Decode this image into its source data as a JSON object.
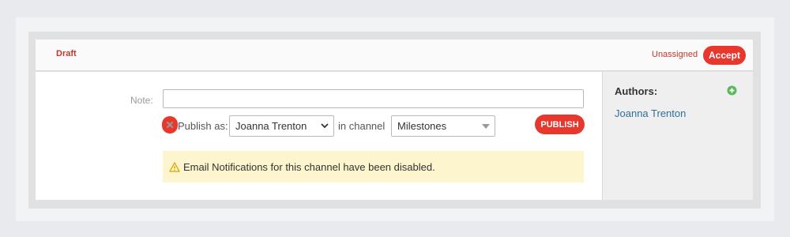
{
  "header": {
    "status": "Draft",
    "assignment": "Unassigned",
    "accept_label": "Accept"
  },
  "form": {
    "note_label": "Note:",
    "note_value": "",
    "publish_as_label": "Publish as:",
    "author_selected": "Joanna Trenton",
    "in_channel_label": "in channel",
    "channel_selected": "Milestones",
    "publish_label": "PUBLISH"
  },
  "alert": {
    "text": "Email Notifications for this channel have been disabled."
  },
  "sidebar": {
    "authors_title": "Authors:",
    "authors": [
      "Joanna Trenton"
    ]
  },
  "colors": {
    "accent": "#e8382d",
    "status_text": "#c0392b",
    "link": "#2f6f9a",
    "alert_bg": "#fcf5cd"
  },
  "icons": {
    "remove": "close-icon",
    "author_dropdown": "chevron-down-icon",
    "channel_dropdown": "caret-down-icon",
    "alert": "warning-icon",
    "add_author": "plus-circle-icon"
  }
}
